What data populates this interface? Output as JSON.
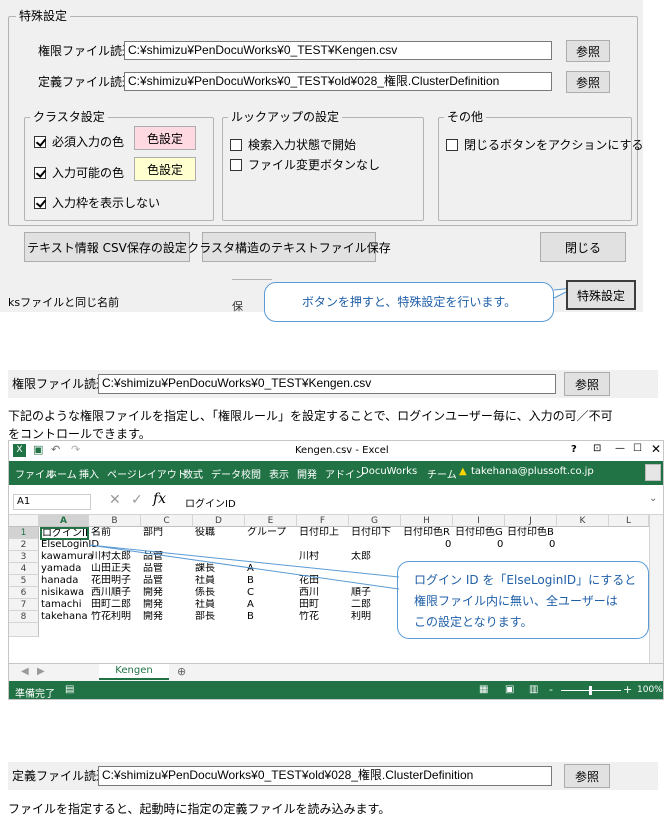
{
  "dialog": {
    "group_title": "特殊設定",
    "auth_file_label": "権限ファイル読込",
    "auth_file_path": "C:¥shimizu¥PenDocuWorks¥0_TEST¥Kengen.csv",
    "def_file_label": "定義ファイル読込",
    "def_file_path": "C:¥shimizu¥PenDocuWorks¥0_TEST¥old¥028_権限.ClusterDefinition",
    "browse_label": "参照",
    "cluster_group_title": "クラスタ設定",
    "required_color_label": "必須入力の色",
    "input_color_label": "入力可能の色",
    "color_button_label": "色設定",
    "hide_input_frame_label": "入力枠を表示しない",
    "lookup_group_title": "ルックアップの設定",
    "start_search_label": "検索入力状態で開始",
    "no_file_change_label": "ファイル変更ボタンなし",
    "other_group_title": "その他",
    "close_as_action_label": "閉じるボタンをアクションにする",
    "text_csv_button": "テキスト情報 CSV保存の設定",
    "cluster_text_button": "クラスタ構造のテキストファイル保存",
    "close_button": "閉じる",
    "special_button": "特殊設定",
    "callout_text": "ボタンを押すと、特殊設定を行います。",
    "bg_label1": "ksファイルと同じ名前",
    "bg_label2": "保"
  },
  "section2": {
    "auth_file_label": "権限ファイル読込",
    "auth_file_path": "C:¥shimizu¥PenDocuWorks¥0_TEST¥Kengen.csv",
    "browse_label": "参照",
    "para_line1": "下記のような権限ファイルを指定し、「権限ルール」を設定することで、ログインユーザー毎に、入力の可／不可",
    "para_line2": "をコントロールできます。"
  },
  "excel": {
    "title": "Kengen.csv - Excel",
    "help": "?",
    "tabs": [
      "ファイル",
      "ホーム",
      "挿入",
      "ページレイアウト",
      "数式",
      "データ",
      "校閲",
      "表示",
      "開発",
      "アドイン",
      "DocuWorks",
      "チーム"
    ],
    "account": "takehana@plussoft.co.jp",
    "name_box": "A1",
    "formula": "ログインID",
    "columns": [
      "A",
      "B",
      "C",
      "D",
      "E",
      "F",
      "G",
      "H",
      "I",
      "J",
      "K",
      "L"
    ],
    "row_numbers": [
      "1",
      "2",
      "3",
      "4",
      "5",
      "6",
      "7",
      "8"
    ],
    "headers": [
      "ログインID",
      "名前",
      "部門",
      "役職",
      "グループ",
      "日付印上",
      "日付印下",
      "日付印色R",
      "日付印色G",
      "日付印色B"
    ],
    "rows": [
      [
        "ElseLoginID",
        "",
        "",
        "",
        "",
        "",
        "",
        "0",
        "0",
        "0"
      ],
      [
        "kawamura",
        "川村太郎",
        "品管",
        "",
        "",
        "川村",
        "太郎",
        "",
        "",
        ""
      ],
      [
        "yamada",
        "山田正夫",
        "品管",
        "課長",
        "A",
        "",
        "",
        "",
        "",
        ""
      ],
      [
        "hanada",
        "花田明子",
        "品管",
        "社員",
        "B",
        "花田",
        "",
        "",
        "",
        ""
      ],
      [
        "nisikawa",
        "西川順子",
        "開発",
        "係長",
        "C",
        "西川",
        "順子",
        "",
        "",
        ""
      ],
      [
        "tamachi",
        "田町二郎",
        "開発",
        "社員",
        "A",
        "田町",
        "二郎",
        "",
        "",
        ""
      ],
      [
        "takehana",
        "竹花利明",
        "開発",
        "部長",
        "B",
        "竹花",
        "利明",
        "",
        "",
        ""
      ]
    ],
    "sheet_tab": "Kengen",
    "status": "準備完了",
    "zoom": "100%",
    "callout_lines": [
      "ログイン ID を「ElseLoginID」にすると",
      "権限ファイル内に無い、全ユーザーは",
      "この設定となります。"
    ]
  },
  "section3": {
    "def_file_label": "定義ファイル読込",
    "def_file_path": "C:¥shimizu¥PenDocuWorks¥0_TEST¥old¥028_権限.ClusterDefinition",
    "browse_label": "参照",
    "para": "ファイルを指定すると、起動時に指定の定義ファイルを読み込みます。"
  },
  "colors": {
    "excel_green": "#217346",
    "callout_border": "#5b9bd5",
    "callout_text": "#1f5fa8",
    "pink_button": "#ffd9e2",
    "yellow_button": "#ffffd0"
  }
}
